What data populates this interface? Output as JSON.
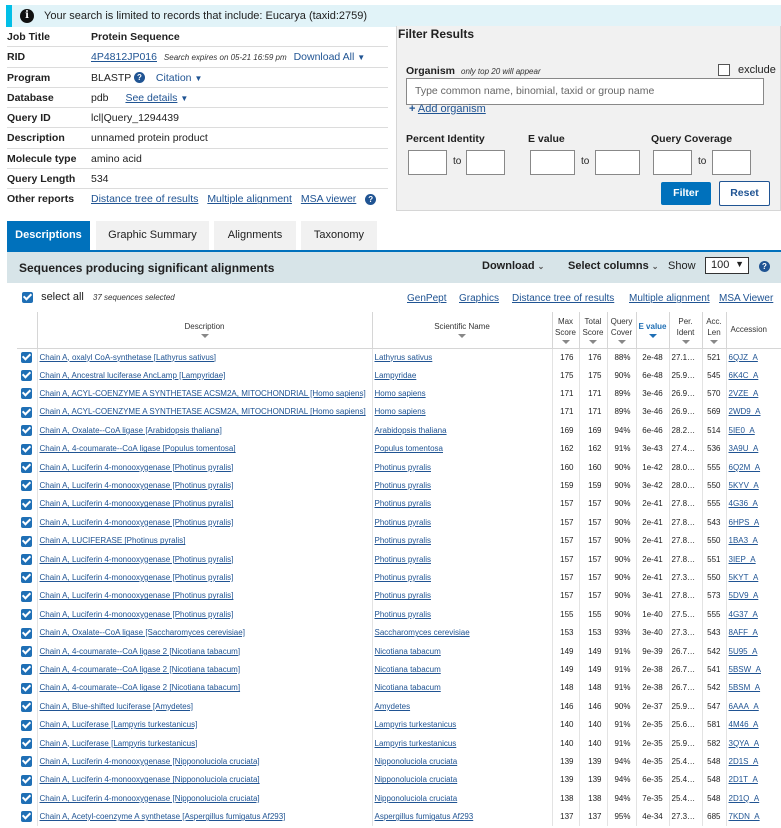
{
  "notice": "Your search is limited to records that include: Eucarya (taxid:2759)",
  "summary": {
    "job_title_label": "Job Title",
    "job_title": "Protein Sequence",
    "rid_label": "RID",
    "rid": "4P4812JP016",
    "rid_expire": "Search expires on 05-21 16:59 pm",
    "download_all": "Download All",
    "program_label": "Program",
    "program": "BLASTP",
    "citation": "Citation",
    "database_label": "Database",
    "database": "pdb",
    "see_details": "See details",
    "query_id_label": "Query ID",
    "query_id": "lcl|Query_1294439",
    "description_label": "Description",
    "description": "unnamed protein product",
    "molecule_type_label": "Molecule type",
    "molecule_type": "amino acid",
    "query_length_label": "Query Length",
    "query_length": "534",
    "other_reports_label": "Other reports",
    "other_reports": [
      "Distance tree of results",
      "Multiple alignment",
      "MSA viewer"
    ]
  },
  "filter": {
    "title": "Filter Results",
    "organism_label": "Organism",
    "organism_note": "only top 20 will appear",
    "exclude": "exclude",
    "organism_placeholder": "Type common  name, binomial, taxid or group  name",
    "add_organism": "Add organism",
    "percent_identity": "Percent Identity",
    "e_value": "E value",
    "query_coverage": "Query Coverage",
    "to": "to",
    "filter_btn": "Filter",
    "reset_btn": "Reset"
  },
  "tabs": [
    "Descriptions",
    "Graphic Summary",
    "Alignments",
    "Taxonomy"
  ],
  "results": {
    "title": "Sequences producing significant alignments",
    "download": "Download",
    "select_columns": "Select columns",
    "show_label": "Show",
    "show_value": "100",
    "select_all": "select all",
    "selected_count": "37 sequences selected",
    "links": [
      "GenPept",
      "Graphics",
      "Distance tree of results",
      "Multiple alignment",
      "MSA Viewer"
    ]
  },
  "table": {
    "headers": [
      "Description",
      "Scientific Name",
      "Max Score",
      "Total Score",
      "Query Cover",
      "E value",
      "Per. Ident",
      "Acc. Len",
      "Accession"
    ],
    "rows": [
      [
        "Chain A, oxalyl CoA-synthetase [Lathyrus sativus]",
        "Lathyrus sativus",
        "176",
        "176",
        "88%",
        "2e-48",
        "27.16%",
        "521",
        "6QJZ_A"
      ],
      [
        "Chain A, Ancestral luciferase AncLamp [Lampyridae]",
        "Lampyridae",
        "175",
        "175",
        "90%",
        "6e-48",
        "25.90%",
        "545",
        "6K4C_A"
      ],
      [
        "Chain A, ACYL-COENZYME A SYNTHETASE ACSM2A, MITOCHONDRIAL [Homo sapiens]",
        "Homo sapiens",
        "171",
        "171",
        "89%",
        "3e-46",
        "26.92%",
        "570",
        "2VZE_A"
      ],
      [
        "Chain A, ACYL-COENZYME A SYNTHETASE ACSM2A, MITOCHONDRIAL [Homo sapiens]",
        "Homo sapiens",
        "171",
        "171",
        "89%",
        "3e-46",
        "26.92%",
        "569",
        "2WD9_A"
      ],
      [
        "Chain A, Oxalate--CoA ligase [Arabidopsis thaliana]",
        "Arabidopsis thaliana",
        "169",
        "169",
        "94%",
        "6e-46",
        "28.21%",
        "514",
        "5IE0_A"
      ],
      [
        "Chain A, 4-coumarate--CoA ligase [Populus tomentosa]",
        "Populus tomentosa",
        "162",
        "162",
        "91%",
        "3e-43",
        "27.47%",
        "536",
        "3A9U_A"
      ],
      [
        "Chain A, Luciferin 4-monooxygenase [Photinus pyralis]",
        "Photinus pyralis",
        "160",
        "160",
        "90%",
        "1e-42",
        "28.06%",
        "555",
        "6Q2M_A"
      ],
      [
        "Chain A, Luciferin 4-monooxygenase [Photinus pyralis]",
        "Photinus pyralis",
        "159",
        "159",
        "90%",
        "3e-42",
        "28.06%",
        "550",
        "5KYV_A"
      ],
      [
        "Chain A, Luciferin 4-monooxygenase [Photinus pyralis]",
        "Photinus pyralis",
        "157",
        "157",
        "90%",
        "2e-41",
        "27.87%",
        "555",
        "4G36_A"
      ],
      [
        "Chain A, Luciferin 4-monooxygenase [Photinus pyralis]",
        "Photinus pyralis",
        "157",
        "157",
        "90%",
        "2e-41",
        "27.87%",
        "543",
        "6HPS_A"
      ],
      [
        "Chain A, LUCIFERASE [Photinus pyralis]",
        "Photinus pyralis",
        "157",
        "157",
        "90%",
        "2e-41",
        "27.87%",
        "550",
        "1BA3_A"
      ],
      [
        "Chain A, Luciferin 4-monooxygenase [Photinus pyralis]",
        "Photinus pyralis",
        "157",
        "157",
        "90%",
        "2e-41",
        "27.87%",
        "551",
        "3IEP_A"
      ],
      [
        "Chain A, Luciferin 4-monooxygenase [Photinus pyralis]",
        "Photinus pyralis",
        "157",
        "157",
        "90%",
        "2e-41",
        "27.35%",
        "550",
        "5KYT_A"
      ],
      [
        "Chain A, Luciferin 4-monooxygenase [Photinus pyralis]",
        "Photinus pyralis",
        "157",
        "157",
        "90%",
        "3e-41",
        "27.87%",
        "573",
        "5DV9_A"
      ],
      [
        "Chain A, Luciferin 4-monooxygenase [Photinus pyralis]",
        "Photinus pyralis",
        "155",
        "155",
        "90%",
        "1e-40",
        "27.54%",
        "555",
        "4G37_A"
      ],
      [
        "Chain A, Oxalate--CoA ligase [Saccharomyces cerevisiae]",
        "Saccharomyces cerevisiae",
        "153",
        "153",
        "93%",
        "3e-40",
        "27.31%",
        "543",
        "8AFF_A"
      ],
      [
        "Chain A, 4-coumarate--CoA ligase 2 [Nicotiana tabacum]",
        "Nicotiana tabacum",
        "149",
        "149",
        "91%",
        "9e-39",
        "26.72%",
        "542",
        "5U95_A"
      ],
      [
        "Chain A, 4-coumarate--CoA ligase 2 [Nicotiana tabacum]",
        "Nicotiana tabacum",
        "149",
        "149",
        "91%",
        "2e-38",
        "26.77%",
        "541",
        "5BSW_A"
      ],
      [
        "Chain A, 4-coumarate--CoA ligase 2 [Nicotiana tabacum]",
        "Nicotiana tabacum",
        "148",
        "148",
        "91%",
        "2e-38",
        "26.72%",
        "542",
        "5BSM_A"
      ],
      [
        "Chain A, Blue-shifted luciferase [Amydetes]",
        "Amydetes",
        "146",
        "146",
        "90%",
        "2e-37",
        "25.90%",
        "547",
        "6AAA_A"
      ],
      [
        "Chain A, Luciferase [Lampyris turkestanicus]",
        "Lampyris turkestanicus",
        "140",
        "140",
        "91%",
        "2e-35",
        "25.60%",
        "581",
        "4M46_A"
      ],
      [
        "Chain A, Luciferase [Lampyris turkestanicus]",
        "Lampyris turkestanicus",
        "140",
        "140",
        "91%",
        "2e-35",
        "25.94%",
        "582",
        "3QYA_A"
      ],
      [
        "Chain A, Luciferin 4-monooxygenase [Nipponoluciola cruciata]",
        "Nipponoluciola cruciata",
        "139",
        "139",
        "94%",
        "4e-35",
        "25.48%",
        "548",
        "2D1S_A"
      ],
      [
        "Chain A, Luciferin 4-monooxygenase [Nipponoluciola cruciata]",
        "Nipponoluciola cruciata",
        "139",
        "139",
        "94%",
        "6e-35",
        "25.48%",
        "548",
        "2D1T_A"
      ],
      [
        "Chain A, Luciferin 4-monooxygenase [Nipponoluciola cruciata]",
        "Nipponoluciola cruciata",
        "138",
        "138",
        "94%",
        "7e-35",
        "25.48%",
        "548",
        "2D1Q_A"
      ],
      [
        "Chain A, Acetyl-coenzyme A synthetase [Aspergillus fumigatus Af293]",
        "Aspergillus fumigatus Af293",
        "137",
        "137",
        "95%",
        "4e-34",
        "27.36%",
        "685",
        "7KDN_A"
      ]
    ]
  }
}
